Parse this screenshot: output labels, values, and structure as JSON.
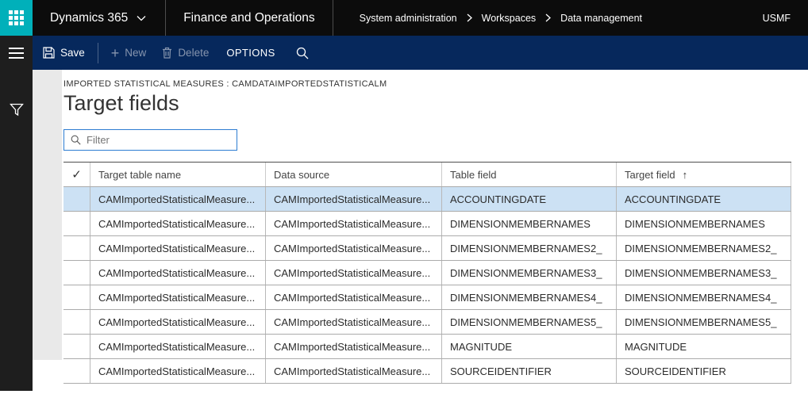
{
  "topbar": {
    "app_menu_label": "Dynamics 365",
    "product_label": "Finance and Operations",
    "breadcrumb": [
      "System administration",
      "Workspaces",
      "Data management"
    ],
    "company": "USMF"
  },
  "toolbar": {
    "save_label": "Save",
    "new_label": "New",
    "delete_label": "Delete",
    "options_label": "OPTIONS"
  },
  "page": {
    "caption": "IMPORTED STATISTICAL MEASURES : CAMDATAIMPORTEDSTATISTICALM",
    "title": "Target fields",
    "filter_placeholder": "Filter"
  },
  "table": {
    "columns": [
      {
        "label": "Target table name"
      },
      {
        "label": "Data source"
      },
      {
        "label": "Table field"
      },
      {
        "label": "Target field"
      }
    ],
    "sort_column": "Target field",
    "sort_direction": "ascending",
    "selected_row_index": 0,
    "rows": [
      {
        "target_table_name": "CAMImportedStatisticalMeasure...",
        "data_source": "CAMImportedStatisticalMeasure...",
        "table_field": "ACCOUNTINGDATE",
        "target_field": "ACCOUNTINGDATE"
      },
      {
        "target_table_name": "CAMImportedStatisticalMeasure...",
        "data_source": "CAMImportedStatisticalMeasure...",
        "table_field": "DIMENSIONMEMBERNAMES",
        "target_field": "DIMENSIONMEMBERNAMES"
      },
      {
        "target_table_name": "CAMImportedStatisticalMeasure...",
        "data_source": "CAMImportedStatisticalMeasure...",
        "table_field": "DIMENSIONMEMBERNAMES2_",
        "target_field": "DIMENSIONMEMBERNAMES2_"
      },
      {
        "target_table_name": "CAMImportedStatisticalMeasure...",
        "data_source": "CAMImportedStatisticalMeasure...",
        "table_field": "DIMENSIONMEMBERNAMES3_",
        "target_field": "DIMENSIONMEMBERNAMES3_"
      },
      {
        "target_table_name": "CAMImportedStatisticalMeasure...",
        "data_source": "CAMImportedStatisticalMeasure...",
        "table_field": "DIMENSIONMEMBERNAMES4_",
        "target_field": "DIMENSIONMEMBERNAMES4_"
      },
      {
        "target_table_name": "CAMImportedStatisticalMeasure...",
        "data_source": "CAMImportedStatisticalMeasure...",
        "table_field": "DIMENSIONMEMBERNAMES5_",
        "target_field": "DIMENSIONMEMBERNAMES5_"
      },
      {
        "target_table_name": "CAMImportedStatisticalMeasure...",
        "data_source": "CAMImportedStatisticalMeasure...",
        "table_field": "MAGNITUDE",
        "target_field": "MAGNITUDE"
      },
      {
        "target_table_name": "CAMImportedStatisticalMeasure...",
        "data_source": "CAMImportedStatisticalMeasure...",
        "table_field": "SOURCEIDENTIFIER",
        "target_field": "SOURCEIDENTIFIER"
      }
    ]
  },
  "icons": {
    "header_check": "✓",
    "sort_ascending": "↑",
    "new_plus": "+"
  },
  "colors": {
    "topbar_bg": "#0c0c0c",
    "accent_teal": "#00b0ba",
    "toolbar_bg": "#06285c",
    "sidebar_bg": "#1e1e1e",
    "selected_row_bg": "#cce1f4",
    "filter_border": "#2d7dd2",
    "disabled_toolbar_text": "#8695ae",
    "grid_line": "#ababab",
    "gutter_bg": "#e9e9e9"
  }
}
